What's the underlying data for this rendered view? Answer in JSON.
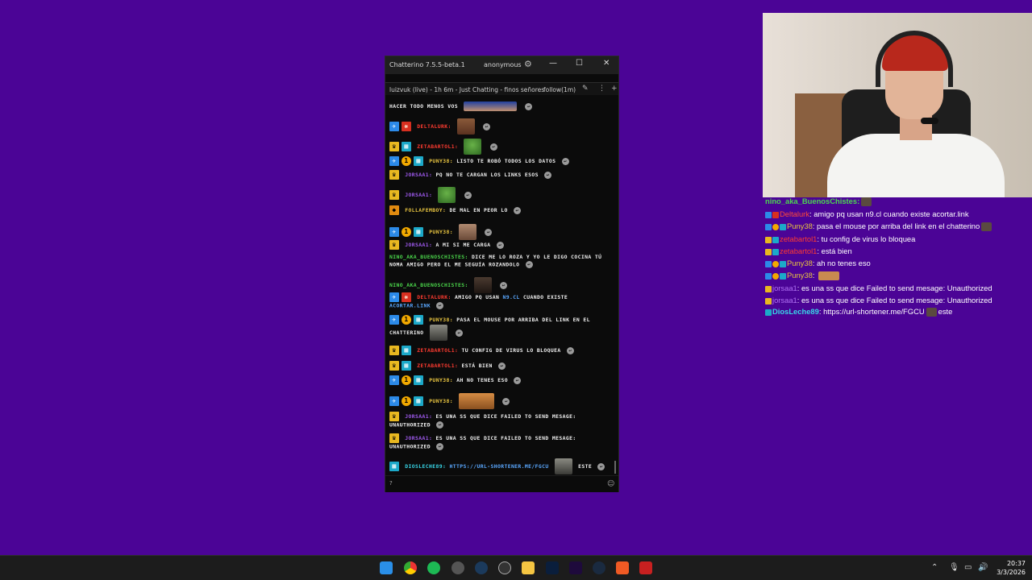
{
  "window": {
    "app_title": "Chatterino 7.5.5-beta.1",
    "user": "anonymous",
    "min": "—",
    "max": "☐",
    "close": "✕"
  },
  "split_header": {
    "title": "luizvuk (live) - 1h 6m - Just Chatting - finos señores",
    "follow": "follow(1m)"
  },
  "messages": [
    {
      "prefix": "",
      "user": "",
      "text": "hacer todo menos vos"
    },
    {
      "user": "Deltalurk:",
      "text": ""
    },
    {
      "user": "zetabartol1:",
      "text": ""
    },
    {
      "user": "Puny38:",
      "text": "listo te robó todos los datos"
    },
    {
      "user": "jorsaa1:",
      "text": "pq no te cargan los links esos"
    },
    {
      "user": "jorsaa1:",
      "text": ""
    },
    {
      "user": "FollaFemboy:",
      "text": "de mal en peor lo"
    },
    {
      "user": "Puny38:",
      "text": ""
    },
    {
      "user": "jorsaa1:",
      "text": "a mi si me carga"
    },
    {
      "user": "nino_aka_BuenosChistes:",
      "text": "dice me lo roza y yo le digo cocina tú noma amigo pero el me seguía rozandolo"
    },
    {
      "user": "nino_aka_BuenosChistes:",
      "text": ""
    },
    {
      "user": "Deltalurk:",
      "text": "amigo pq usan ",
      "link": "n9.cl",
      "text2": " cuando existe ",
      "link2": "acortar.link"
    },
    {
      "user": "Puny38:",
      "text": "pasa el mouse por arriba del link en el chatterino"
    },
    {
      "user": "zetabartol1:",
      "text": "tu config de virus lo bloquea"
    },
    {
      "user": "zetabartol1:",
      "text": "está bien"
    },
    {
      "user": "Puny38:",
      "text": "ah no tenes eso"
    },
    {
      "user": "Puny38:",
      "text": ""
    },
    {
      "user": "jorsaa1:",
      "text": "es una ss que dice Failed to send mesage: Unauthorized"
    },
    {
      "user": "jorsaa1:",
      "text": "es una ss que dice Failed to send mesage: Unauthorized"
    },
    {
      "user": "DiosLeche89:",
      "link": "https://url-shortener.me/FGCU",
      "text": "este"
    }
  ],
  "input": {
    "caret": "?",
    "emoji": "☺"
  },
  "overlay": [
    {
      "user": "nino_aka_BuenosChistes",
      "text": ""
    },
    {
      "user": "Deltalurk",
      "text": "amigo pq usan n9.cl cuando existe acortar.link"
    },
    {
      "user": "Puny38",
      "text": "pasa el mouse por arriba del link en el chatterino"
    },
    {
      "user": "zetabartol1",
      "text": "tu config de virus lo bloquea"
    },
    {
      "user": "zetabartol1",
      "text": "está bien"
    },
    {
      "user": "Puny38",
      "text": "ah no tenes eso"
    },
    {
      "user": "Puny38",
      "text": ""
    },
    {
      "user": "jorsaa1",
      "text": "es una ss que dice Failed to send mesage: Unauthorized"
    },
    {
      "user": "jorsaa1",
      "text": "es una ss que dice Failed to send mesage: Unauthorized"
    },
    {
      "user": "DiosLeche89",
      "text": "https://url-shortener.me/FGCU",
      "text2": "este"
    }
  ],
  "taskbar": {
    "apps": [
      "windows-start",
      "chrome",
      "spotify",
      "discord-alt",
      "steam",
      "obs",
      "file-explorer",
      "photoshop",
      "premiere",
      "ccleaner",
      "brave",
      "voicemeeter"
    ],
    "time": "20:37",
    "date": "3/3/2026"
  },
  "colors": {
    "background": "#4b0496",
    "window": "#0b0b0b"
  }
}
